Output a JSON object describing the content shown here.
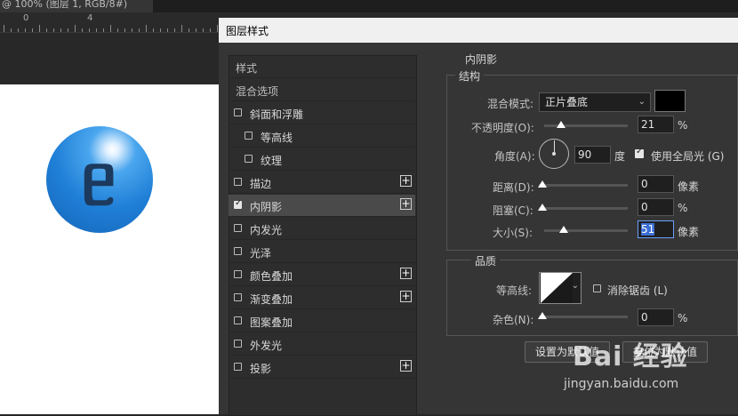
{
  "document": {
    "tab_label": "@ 100% (图层 1, RGB/8#)"
  },
  "ruler": {
    "marks": [
      "0",
      "4"
    ]
  },
  "dialog": {
    "title": "图层样式",
    "left_items": [
      {
        "label": "样式",
        "type": "header"
      },
      {
        "label": "混合选项",
        "type": "header"
      },
      {
        "label": "斜面和浮雕",
        "checked": false,
        "plus": false,
        "indent": 0
      },
      {
        "label": "等高线",
        "checked": false,
        "plus": false,
        "indent": 1
      },
      {
        "label": "纹理",
        "checked": false,
        "plus": false,
        "indent": 1
      },
      {
        "label": "描边",
        "checked": false,
        "plus": true,
        "indent": 0
      },
      {
        "label": "内阴影",
        "checked": true,
        "plus": true,
        "indent": 0,
        "selected": true
      },
      {
        "label": "内发光",
        "checked": false,
        "plus": false,
        "indent": 0
      },
      {
        "label": "光泽",
        "checked": false,
        "plus": false,
        "indent": 0
      },
      {
        "label": "颜色叠加",
        "checked": false,
        "plus": true,
        "indent": 0
      },
      {
        "label": "渐变叠加",
        "checked": false,
        "plus": true,
        "indent": 0
      },
      {
        "label": "图案叠加",
        "checked": false,
        "plus": false,
        "indent": 0
      },
      {
        "label": "外发光",
        "checked": false,
        "plus": false,
        "indent": 0
      },
      {
        "label": "投影",
        "checked": false,
        "plus": true,
        "indent": 0
      }
    ],
    "section_title": "内阴影",
    "structure": {
      "title": "结构",
      "blend_mode_label": "混合模式:",
      "blend_mode_value": "正片叠底",
      "shadow_color": "#000000",
      "opacity_label": "不透明度(O):",
      "opacity_value": "21",
      "opacity_unit": "%",
      "angle_label": "角度(A):",
      "angle_value": "90",
      "angle_unit": "度",
      "global_light_label": "使用全局光 (G)",
      "global_light_checked": true,
      "distance_label": "距离(D):",
      "distance_value": "0",
      "distance_unit": "像素",
      "choke_label": "阻塞(C):",
      "choke_value": "0",
      "choke_unit": "%",
      "size_label": "大小(S):",
      "size_value": "51",
      "size_unit": "像素"
    },
    "quality": {
      "title": "品质",
      "contour_label": "等高线:",
      "anti_alias_label": "消除锯齿 (L)",
      "anti_alias_checked": false,
      "noise_label": "杂色(N):",
      "noise_value": "0",
      "noise_unit": "%"
    },
    "buttons": {
      "set_default": "设置为默认值",
      "reset_default": "复位为默认值"
    }
  },
  "watermark": {
    "brand": "Bai 经验",
    "url": "jingyan.baidu.com"
  }
}
